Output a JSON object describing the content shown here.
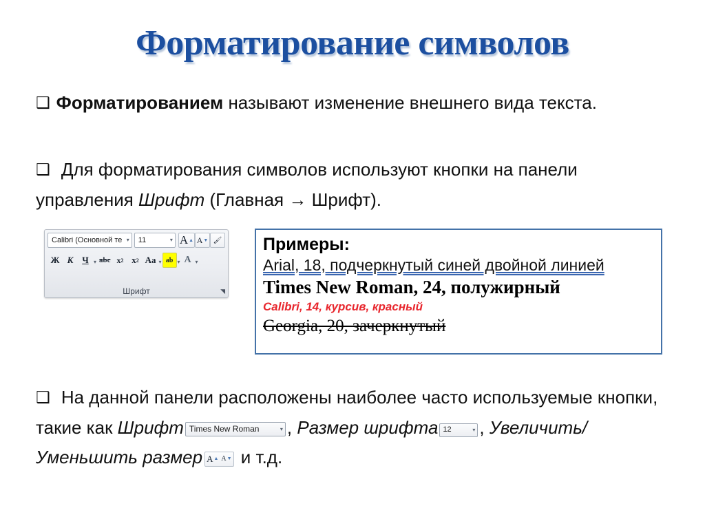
{
  "slide": {
    "title": "Форматирование символов",
    "title_color": "#1c4fa0"
  },
  "bullets": {
    "marker": "❑",
    "item1": {
      "bold_lead": "Форматированием",
      "rest": " называют изменение внешнего вида текста."
    },
    "item2": {
      "part1": " Для форматирования символов используют кнопки на панели управления ",
      "italic1": "Шрифт",
      "part2": " (Главная ",
      "arrow": "→",
      "part3": " Шрифт)."
    },
    "item3": {
      "part1": " На данной панели расположены наиболее часто используемые кнопки, такие как ",
      "italic1": "Шрифт",
      "part2": ", ",
      "italic2": "Размер шрифта",
      "part3": ", ",
      "italic3": "Увеличить/Уменьшить размер",
      "part4": " и т.д."
    }
  },
  "ribbon": {
    "font_name": "Calibri (Основной те",
    "font_size": "11",
    "group_label": "Шрифт",
    "caret": "▾",
    "buttons": {
      "grow_font": "A",
      "shrink_font": "A",
      "clear_formatting": "A",
      "bold": "Ж",
      "italic": "К",
      "underline": "Ч",
      "strikethrough": "abc",
      "subscript": "x",
      "subscript_index": "2",
      "superscript": "x",
      "superscript_index": "2",
      "change_case": "Aa",
      "highlight": "ab",
      "font_color": "A"
    },
    "dialog_launcher": "⌐"
  },
  "examples": {
    "heading": "Примеры:",
    "line1": "Arial, 18, подчеркнутый синей двойной линией",
    "line2": "Times New Roman, 24, полужирный",
    "line3": "Calibri, 14, курсив, красный",
    "line4": "Georgia, 20, зачеркнутый",
    "border_color": "#4472a8",
    "line1_underline_color": "#3a66b0",
    "line3_color": "#e8262d"
  },
  "inline_controls": {
    "font_name_value": "Times New Roman",
    "font_size_value": "12",
    "caret": "▾",
    "grow_letter": "A",
    "shrink_letter": "A"
  }
}
